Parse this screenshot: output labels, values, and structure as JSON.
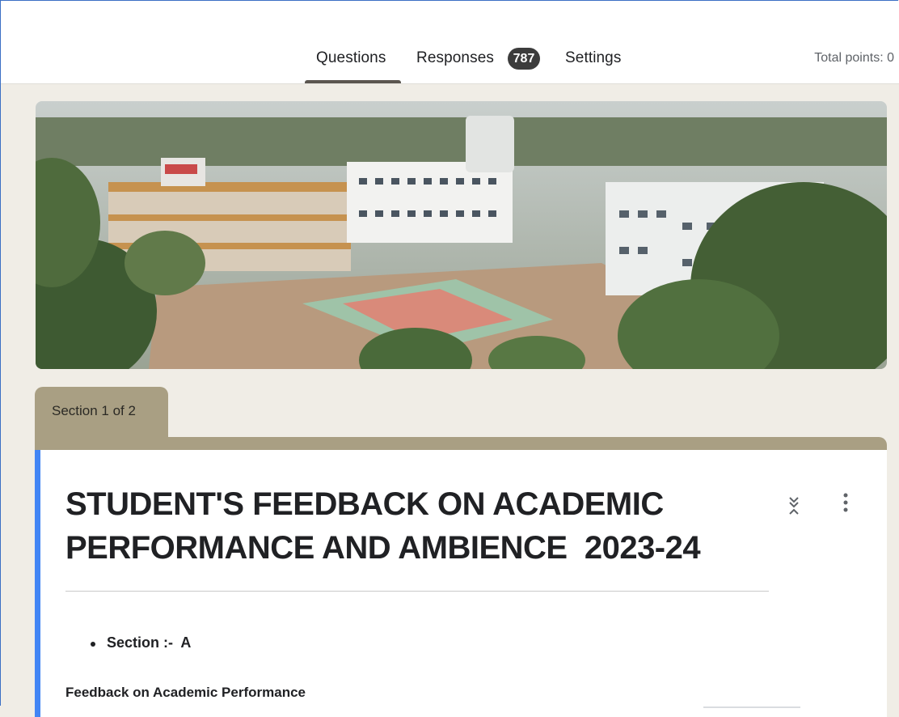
{
  "tabs": {
    "questions": "Questions",
    "responses": "Responses",
    "responses_count": "787",
    "settings": "Settings"
  },
  "total_points": "Total points: 0",
  "banner": {
    "image": "college campus aerial photo"
  },
  "section": {
    "label": "Section 1 of 2"
  },
  "form": {
    "title": "STUDENT'S FEEDBACK ON ACADEMIC PERFORMANCE AND AMBIENCE  2023-24",
    "bullet": "Section :-  A",
    "subheading": "Feedback on Academic Performance"
  },
  "icons": {
    "collapse": "collapse-expand-icon",
    "more": "more-vert-icon"
  },
  "colors": {
    "accent": "#4285f4",
    "section_tab": "#a99f83",
    "badge": "#3c3c3c",
    "page_bg": "#f0ede6"
  }
}
